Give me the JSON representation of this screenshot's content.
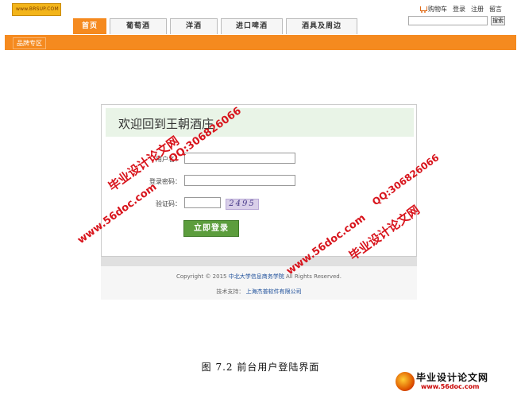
{
  "header": {
    "logo_text": "www.BRSUP.COM",
    "top_links": {
      "cart": "购物车",
      "login": "登录",
      "register": "注册",
      "message": "留言"
    },
    "search_button": "搜索"
  },
  "nav": {
    "tabs": [
      "首页",
      "葡萄酒",
      "洋酒",
      "进口啤酒",
      "酒具及周边"
    ],
    "active_tab": "首页",
    "brand_zone": "品牌专区"
  },
  "login": {
    "welcome": "欢迎回到王朝酒庄",
    "username_label": "用户名：",
    "password_label": "登录密码：",
    "captcha_label": "验证码：",
    "captcha_value": "2495",
    "submit": "立即登录"
  },
  "footer": {
    "copyright_prefix": "Copyright © 2015",
    "copyright_org": "中北大学信息商务学院",
    "copyright_suffix": "All Rights Reserved.",
    "support_label": "技术支持：",
    "support_org": "上海杰普软件有限公司"
  },
  "watermarks": {
    "site": "毕业设计论文网",
    "url": "www.56doc.com",
    "qq": "QQ:306826066"
  },
  "caption": "图 7.2  前台用户登陆界面",
  "brand_mark": {
    "title": "毕业设计论文网",
    "url": "www.56doc.com"
  },
  "colors": {
    "accent": "#f58a1f",
    "login_button": "#5c9d3d",
    "watermark": "#d8141c"
  }
}
